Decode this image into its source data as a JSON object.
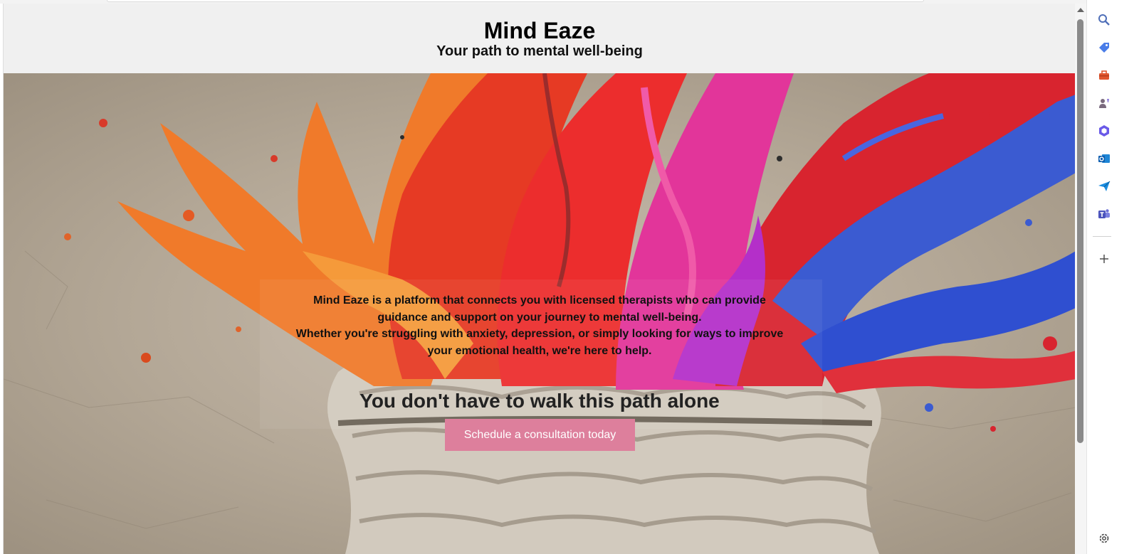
{
  "header": {
    "title": "Mind Eaze",
    "subtitle": "Your path to mental well-being"
  },
  "hero": {
    "description_line1": "Mind Eaze is a platform that connects you with licensed therapists who can provide guidance and support on your journey to mental well-being.",
    "description_line2": "Whether you're struggling with anxiety, depression, or simply looking for ways to improve your emotional health, we're here to help.",
    "heading": "You don't have to walk this path alone",
    "cta_label": "Schedule a consultation today"
  },
  "sidebar": {
    "icons": [
      "search-icon",
      "tag-icon",
      "toolbox-icon",
      "chess-user-icon",
      "copilot-icon",
      "outlook-icon",
      "send-icon",
      "teams-icon",
      "add-icon",
      "settings-icon"
    ]
  },
  "colors": {
    "header_bg": "#f0f0f0",
    "cta_bg": "#dd7f9c",
    "cta_text": "#ffffff"
  }
}
